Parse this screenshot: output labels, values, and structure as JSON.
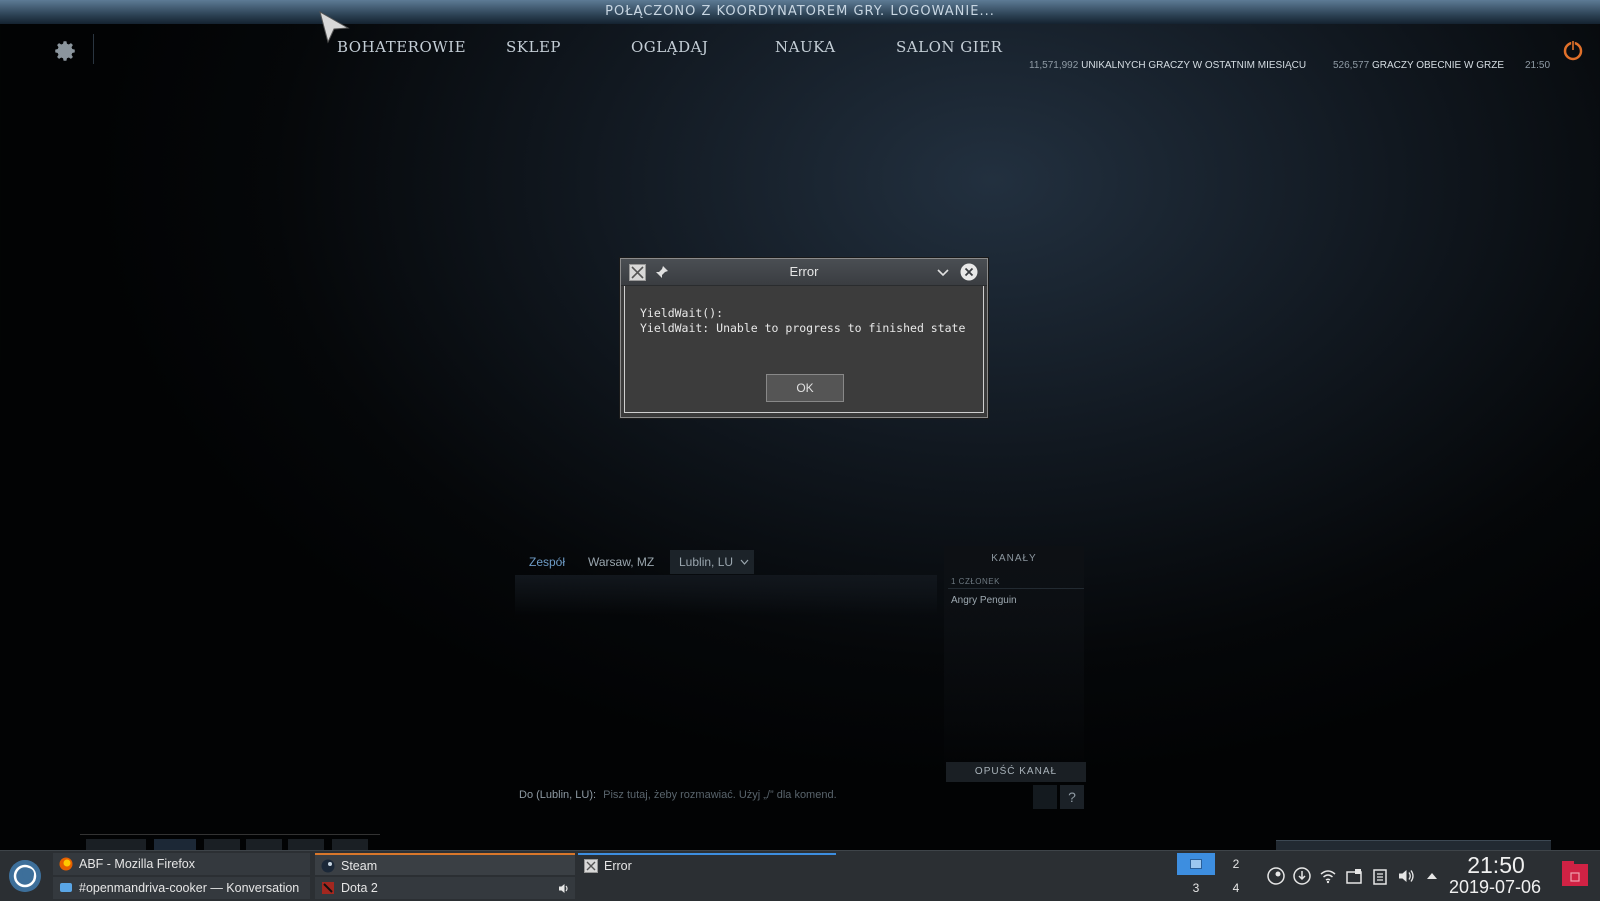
{
  "top_status": {
    "text": "POŁĄCZONO Z KOORDYNATOREM GRY. LOGOWANIE..."
  },
  "nav": {
    "items": [
      {
        "label": "BOHATEROWIE"
      },
      {
        "label": "SKLEP"
      },
      {
        "label": "OGLĄDAJ"
      },
      {
        "label": "NAUKA"
      },
      {
        "label": "SALON GIER"
      }
    ]
  },
  "stats": {
    "unique_players_num": "11,571,992",
    "unique_players_label": "UNIKALNYCH GRACZY W OSTATNIM MIESIĄCU",
    "current_players_num": "526,577",
    "current_players_label": "GRACZY OBECNIE W GRZE",
    "time": "21:50"
  },
  "dialog": {
    "title": "Error",
    "message": "YieldWait():\nYieldWait: Unable to progress to finished state",
    "ok_label": "OK"
  },
  "chat": {
    "tabs": [
      {
        "label": "Zespół",
        "active": false
      },
      {
        "label": "Warsaw, MZ",
        "active": false
      },
      {
        "label": "Lublin, LU",
        "active": true
      }
    ],
    "channels_title": "KANAŁY",
    "members_header": "1 CZŁONEK",
    "members": [
      "Angry Penguin"
    ],
    "leave_label": "OPUŚĆ KANAŁ",
    "input_target": "Do (Lublin, LU):",
    "input_placeholder": "Pisz tutaj, żeby rozmawiać. Użyj „/” dla komend.",
    "help_label": "?"
  },
  "taskbar": {
    "tasks": [
      {
        "label": "ABF - Mozilla Firefox",
        "icon": "firefox-icon"
      },
      {
        "label": "#openmandriva-cooker — Konversation",
        "icon": "konversation-icon"
      },
      {
        "label": "Steam",
        "icon": "steam-icon"
      },
      {
        "label": "Dota 2",
        "icon": "dota-icon"
      },
      {
        "label": "Error",
        "icon": "x-window-icon"
      }
    ],
    "pager": [
      "2",
      "3",
      "4"
    ],
    "clock_time": "21:50",
    "clock_date": "2019-07-06"
  },
  "colors": {
    "accent_orange": "#e0702a",
    "active_task": "#d9772b",
    "focus_task": "#3d8ee0"
  }
}
